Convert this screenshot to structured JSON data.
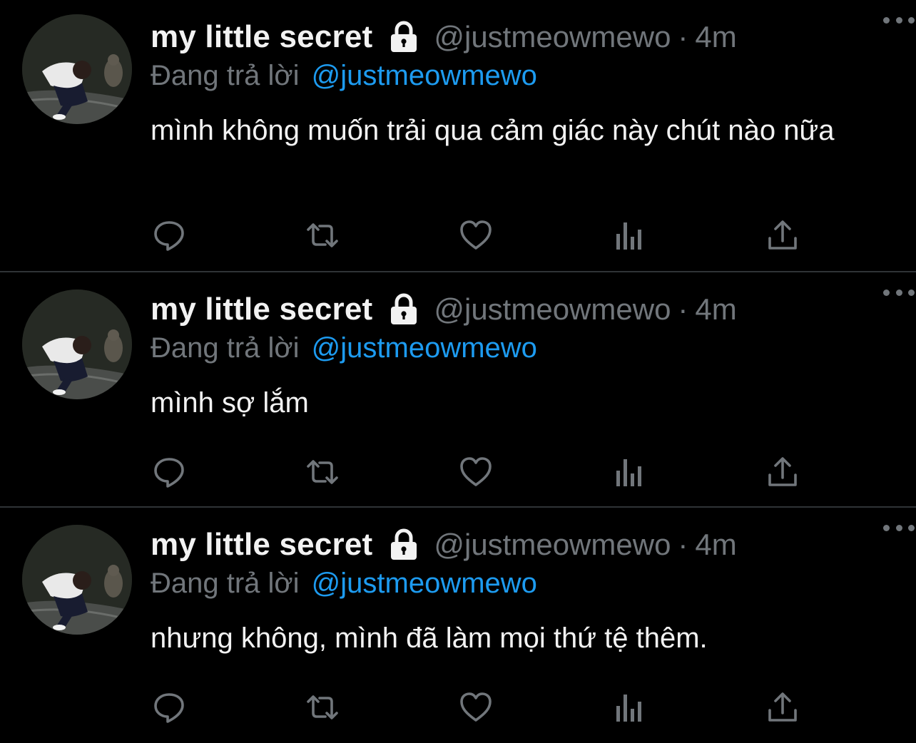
{
  "tweets": [
    {
      "name": "my little secret",
      "handle": "@justmeowmewo",
      "separator": "·",
      "time": "4m",
      "reply_prefix": "Đang trả lời",
      "reply_to": "@justmeowmewo",
      "text": "mình không muốn trải qua cảm giác này chút nào nữa"
    },
    {
      "name": "my little secret",
      "handle": "@justmeowmewo",
      "separator": "·",
      "time": "4m",
      "reply_prefix": "Đang trả lời",
      "reply_to": "@justmeowmewo",
      "text": "mình sợ lắm"
    },
    {
      "name": "my little secret",
      "handle": "@justmeowmewo",
      "separator": "·",
      "time": "4m",
      "reply_prefix": "Đang trả lời",
      "reply_to": "@justmeowmewo",
      "text": "nhưng không, mình đã làm mọi thứ tệ thêm."
    }
  ],
  "icons": {
    "lock": "lock-icon",
    "more": "more-icon",
    "reply": "reply-icon",
    "retweet": "retweet-icon",
    "like": "heart-icon",
    "views": "views-icon",
    "share": "share-icon"
  },
  "colors": {
    "background": "#000000",
    "text": "#f2f2f2",
    "muted": "#71767b",
    "accent": "#1d9bf0",
    "divider": "#2f3336"
  }
}
